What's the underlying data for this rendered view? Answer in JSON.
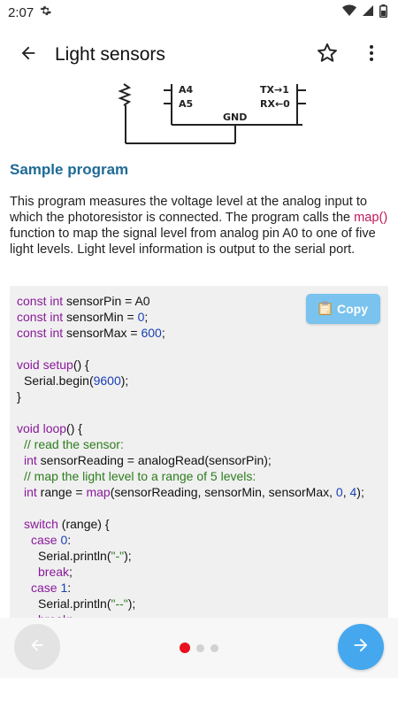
{
  "status_bar": {
    "time": "2:07",
    "icons": [
      "gear-icon",
      "wifi-icon",
      "signal-icon",
      "battery-icon"
    ]
  },
  "app_bar": {
    "title": "Light sensors",
    "back_icon": "arrow-left-icon",
    "actions": [
      "star-outline-icon",
      "more-vert-icon"
    ]
  },
  "schematic": {
    "pins_left": [
      "A4",
      "A5"
    ],
    "pins_right": [
      "TX→1",
      "RX←0"
    ],
    "ground": "GND"
  },
  "section": {
    "title": "Sample program"
  },
  "description": {
    "before": "This program measures the voltage level at the analog input to which the photoresistor is connected. The program calls the ",
    "function": "map()",
    "after": " function to map the signal level from analog pin A0 to one of five light levels. Light level information is output to the serial port."
  },
  "code": {
    "copy_label": "Copy",
    "copy_icon": "clipboard-icon",
    "lines": [
      {
        "i": 0,
        "t": [
          [
            "kw",
            "const int"
          ],
          [
            "p",
            " sensorPin = A0"
          ]
        ]
      },
      {
        "i": 0,
        "t": [
          [
            "kw",
            "const int"
          ],
          [
            "p",
            " sensorMin = "
          ],
          [
            "num",
            "0"
          ],
          [
            "p",
            ";"
          ]
        ]
      },
      {
        "i": 0,
        "t": [
          [
            "kw",
            "const int"
          ],
          [
            "p",
            " sensorMax = "
          ],
          [
            "num",
            "600"
          ],
          [
            "p",
            ";"
          ]
        ]
      },
      {
        "i": 0,
        "t": []
      },
      {
        "i": 0,
        "t": [
          [
            "kw",
            "void"
          ],
          [
            "p",
            " "
          ],
          [
            "kw",
            "setup"
          ],
          [
            "p",
            "() {"
          ]
        ]
      },
      {
        "i": 1,
        "t": [
          [
            "p",
            "Serial.begin("
          ],
          [
            "num",
            "9600"
          ],
          [
            "p",
            ");"
          ]
        ]
      },
      {
        "i": 0,
        "t": [
          [
            "p",
            "}"
          ]
        ]
      },
      {
        "i": 0,
        "t": []
      },
      {
        "i": 0,
        "t": [
          [
            "kw",
            "void"
          ],
          [
            "p",
            " "
          ],
          [
            "kw",
            "loop"
          ],
          [
            "p",
            "() {"
          ]
        ]
      },
      {
        "i": 1,
        "t": [
          [
            "cm",
            "// read the sensor:"
          ]
        ]
      },
      {
        "i": 1,
        "t": [
          [
            "kw",
            "int"
          ],
          [
            "p",
            " sensorReading = analogRead(sensorPin);"
          ]
        ]
      },
      {
        "i": 1,
        "t": [
          [
            "cm",
            "// map the light level to a range of 5 levels:"
          ]
        ]
      },
      {
        "i": 1,
        "t": [
          [
            "kw",
            "int"
          ],
          [
            "p",
            " range = "
          ],
          [
            "kw",
            "map"
          ],
          [
            "p",
            "(sensorReading, sensorMin, sensorMax, "
          ],
          [
            "num",
            "0"
          ],
          [
            "p",
            ", "
          ],
          [
            "num",
            "4"
          ],
          [
            "p",
            ");"
          ]
        ]
      },
      {
        "i": 0,
        "t": []
      },
      {
        "i": 1,
        "t": [
          [
            "kw",
            "switch"
          ],
          [
            "p",
            " (range) {"
          ]
        ]
      },
      {
        "i": 2,
        "t": [
          [
            "kw",
            "case"
          ],
          [
            "p",
            " "
          ],
          [
            "num",
            "0"
          ],
          [
            "p",
            ":"
          ]
        ]
      },
      {
        "i": 3,
        "t": [
          [
            "p",
            "Serial.println("
          ],
          [
            "str",
            "\"-\""
          ],
          [
            "p",
            ");"
          ]
        ]
      },
      {
        "i": 3,
        "t": [
          [
            "kw",
            "break"
          ],
          [
            "p",
            ";"
          ]
        ]
      },
      {
        "i": 2,
        "t": [
          [
            "kw",
            "case"
          ],
          [
            "p",
            " "
          ],
          [
            "num",
            "1"
          ],
          [
            "p",
            ":"
          ]
        ]
      },
      {
        "i": 3,
        "t": [
          [
            "p",
            "Serial.println("
          ],
          [
            "str",
            "\"--\""
          ],
          [
            "p",
            ");"
          ]
        ]
      },
      {
        "i": 3,
        "t": [
          [
            "kw",
            "break"
          ],
          [
            "p",
            ";"
          ]
        ]
      }
    ]
  },
  "bottom_nav": {
    "prev_icon": "arrow-left-icon",
    "next_icon": "arrow-right-icon",
    "page_count": 3,
    "active_page": 1,
    "colors": {
      "active_dot": "#e8101e",
      "next_button": "#45a8ee",
      "prev_button": "#e3e3e3"
    }
  }
}
